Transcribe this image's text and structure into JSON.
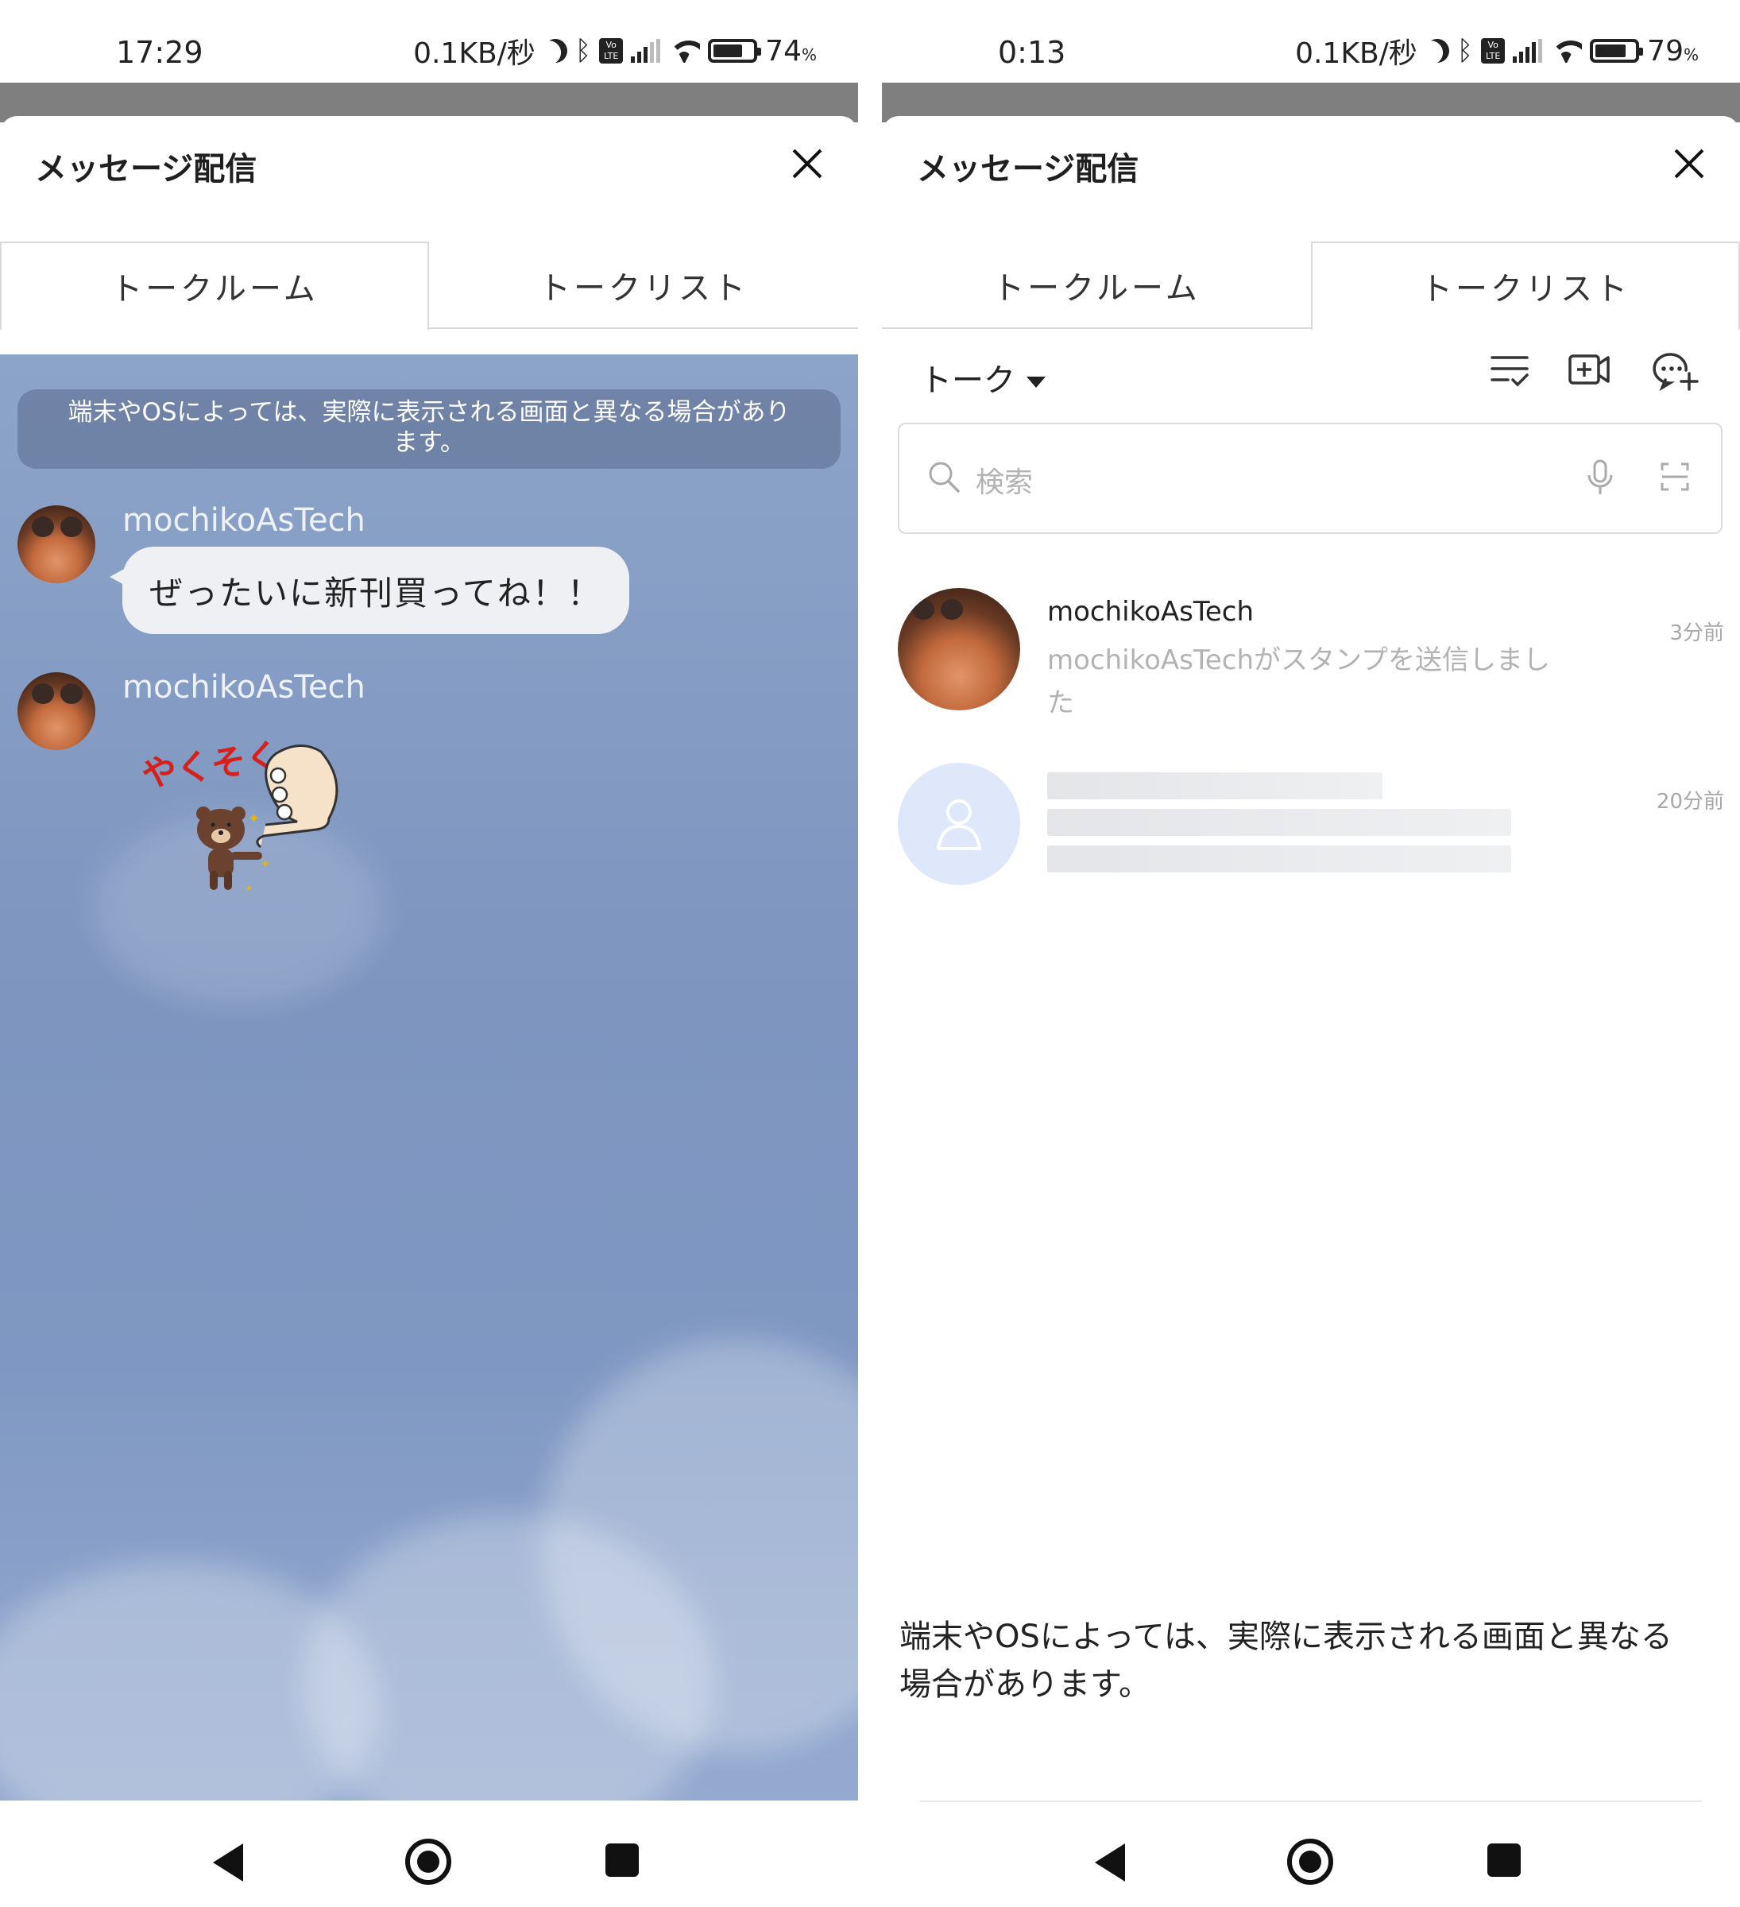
{
  "left_screen": {
    "status": {
      "time": "17:29",
      "net_speed": "0.1KB/秒",
      "battery_percent": "74",
      "battery_level": 0.74
    },
    "sheet_title": "メッセージ配信",
    "tabs": [
      {
        "label": "トークルーム",
        "active": true
      },
      {
        "label": "トークリスト",
        "active": false
      }
    ],
    "notice": "端末やOSによっては、実際に表示される画面と異なる場合があり\nます。",
    "messages": [
      {
        "sender": "mochikoAsTech",
        "text": "ぜったいに新刊買ってね！！"
      },
      {
        "sender": "mochikoAsTech",
        "sticker": "brown-bear-promise-sticker",
        "sticker_text": "やくそく"
      }
    ]
  },
  "right_screen": {
    "status": {
      "time": "0:13",
      "net_speed": "0.1KB/秒",
      "battery_percent": "79",
      "battery_level": 0.79
    },
    "sheet_title": "メッセージ配信",
    "tabs": [
      {
        "label": "トークルーム",
        "active": false
      },
      {
        "label": "トークリスト",
        "active": true
      }
    ],
    "filter_label": "トーク",
    "search_placeholder": "検索",
    "chats": [
      {
        "name": "mochikoAsTech",
        "preview": "mochikoAsTechがスタンプを送信しまし\nた",
        "time": "3分前"
      },
      {
        "name": "",
        "preview": "",
        "time": "20分前",
        "placeholder": true
      }
    ],
    "bottom_notice": "端末やOSによっては、実際に表示される画面と異なる\n場合があります。"
  },
  "icons": [
    "moon-icon",
    "bluetooth-icon",
    "volte-icon",
    "signal-icon",
    "wifi-icon",
    "battery-icon",
    "close-icon",
    "sort-icon",
    "video-call-icon",
    "new-chat-icon",
    "search-icon",
    "mic-icon",
    "scan-icon",
    "back-icon",
    "home-icon",
    "recents-icon"
  ],
  "colors": {
    "chat_background": "#7d95bf",
    "bubble": "#eef0f3",
    "dim_overlay": "#7f7f7f",
    "default_avatar": "#dfe8fb"
  }
}
